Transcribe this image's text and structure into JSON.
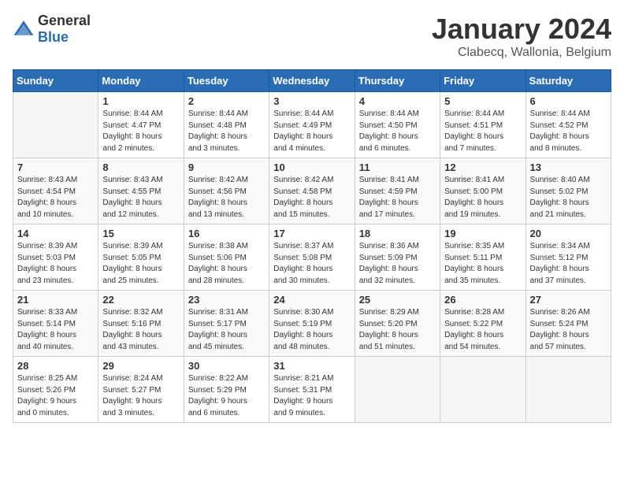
{
  "header": {
    "logo_general": "General",
    "logo_blue": "Blue",
    "main_title": "January 2024",
    "sub_title": "Clabecq, Wallonia, Belgium"
  },
  "calendar": {
    "days_of_week": [
      "Sunday",
      "Monday",
      "Tuesday",
      "Wednesday",
      "Thursday",
      "Friday",
      "Saturday"
    ],
    "weeks": [
      [
        {
          "day": "",
          "info": ""
        },
        {
          "day": "1",
          "info": "Sunrise: 8:44 AM\nSunset: 4:47 PM\nDaylight: 8 hours\nand 2 minutes."
        },
        {
          "day": "2",
          "info": "Sunrise: 8:44 AM\nSunset: 4:48 PM\nDaylight: 8 hours\nand 3 minutes."
        },
        {
          "day": "3",
          "info": "Sunrise: 8:44 AM\nSunset: 4:49 PM\nDaylight: 8 hours\nand 4 minutes."
        },
        {
          "day": "4",
          "info": "Sunrise: 8:44 AM\nSunset: 4:50 PM\nDaylight: 8 hours\nand 6 minutes."
        },
        {
          "day": "5",
          "info": "Sunrise: 8:44 AM\nSunset: 4:51 PM\nDaylight: 8 hours\nand 7 minutes."
        },
        {
          "day": "6",
          "info": "Sunrise: 8:44 AM\nSunset: 4:52 PM\nDaylight: 8 hours\nand 8 minutes."
        }
      ],
      [
        {
          "day": "7",
          "info": "Sunrise: 8:43 AM\nSunset: 4:54 PM\nDaylight: 8 hours\nand 10 minutes."
        },
        {
          "day": "8",
          "info": "Sunrise: 8:43 AM\nSunset: 4:55 PM\nDaylight: 8 hours\nand 12 minutes."
        },
        {
          "day": "9",
          "info": "Sunrise: 8:42 AM\nSunset: 4:56 PM\nDaylight: 8 hours\nand 13 minutes."
        },
        {
          "day": "10",
          "info": "Sunrise: 8:42 AM\nSunset: 4:58 PM\nDaylight: 8 hours\nand 15 minutes."
        },
        {
          "day": "11",
          "info": "Sunrise: 8:41 AM\nSunset: 4:59 PM\nDaylight: 8 hours\nand 17 minutes."
        },
        {
          "day": "12",
          "info": "Sunrise: 8:41 AM\nSunset: 5:00 PM\nDaylight: 8 hours\nand 19 minutes."
        },
        {
          "day": "13",
          "info": "Sunrise: 8:40 AM\nSunset: 5:02 PM\nDaylight: 8 hours\nand 21 minutes."
        }
      ],
      [
        {
          "day": "14",
          "info": "Sunrise: 8:39 AM\nSunset: 5:03 PM\nDaylight: 8 hours\nand 23 minutes."
        },
        {
          "day": "15",
          "info": "Sunrise: 8:39 AM\nSunset: 5:05 PM\nDaylight: 8 hours\nand 25 minutes."
        },
        {
          "day": "16",
          "info": "Sunrise: 8:38 AM\nSunset: 5:06 PM\nDaylight: 8 hours\nand 28 minutes."
        },
        {
          "day": "17",
          "info": "Sunrise: 8:37 AM\nSunset: 5:08 PM\nDaylight: 8 hours\nand 30 minutes."
        },
        {
          "day": "18",
          "info": "Sunrise: 8:36 AM\nSunset: 5:09 PM\nDaylight: 8 hours\nand 32 minutes."
        },
        {
          "day": "19",
          "info": "Sunrise: 8:35 AM\nSunset: 5:11 PM\nDaylight: 8 hours\nand 35 minutes."
        },
        {
          "day": "20",
          "info": "Sunrise: 8:34 AM\nSunset: 5:12 PM\nDaylight: 8 hours\nand 37 minutes."
        }
      ],
      [
        {
          "day": "21",
          "info": "Sunrise: 8:33 AM\nSunset: 5:14 PM\nDaylight: 8 hours\nand 40 minutes."
        },
        {
          "day": "22",
          "info": "Sunrise: 8:32 AM\nSunset: 5:16 PM\nDaylight: 8 hours\nand 43 minutes."
        },
        {
          "day": "23",
          "info": "Sunrise: 8:31 AM\nSunset: 5:17 PM\nDaylight: 8 hours\nand 45 minutes."
        },
        {
          "day": "24",
          "info": "Sunrise: 8:30 AM\nSunset: 5:19 PM\nDaylight: 8 hours\nand 48 minutes."
        },
        {
          "day": "25",
          "info": "Sunrise: 8:29 AM\nSunset: 5:20 PM\nDaylight: 8 hours\nand 51 minutes."
        },
        {
          "day": "26",
          "info": "Sunrise: 8:28 AM\nSunset: 5:22 PM\nDaylight: 8 hours\nand 54 minutes."
        },
        {
          "day": "27",
          "info": "Sunrise: 8:26 AM\nSunset: 5:24 PM\nDaylight: 8 hours\nand 57 minutes."
        }
      ],
      [
        {
          "day": "28",
          "info": "Sunrise: 8:25 AM\nSunset: 5:26 PM\nDaylight: 9 hours\nand 0 minutes."
        },
        {
          "day": "29",
          "info": "Sunrise: 8:24 AM\nSunset: 5:27 PM\nDaylight: 9 hours\nand 3 minutes."
        },
        {
          "day": "30",
          "info": "Sunrise: 8:22 AM\nSunset: 5:29 PM\nDaylight: 9 hours\nand 6 minutes."
        },
        {
          "day": "31",
          "info": "Sunrise: 8:21 AM\nSunset: 5:31 PM\nDaylight: 9 hours\nand 9 minutes."
        },
        {
          "day": "",
          "info": ""
        },
        {
          "day": "",
          "info": ""
        },
        {
          "day": "",
          "info": ""
        }
      ]
    ]
  }
}
